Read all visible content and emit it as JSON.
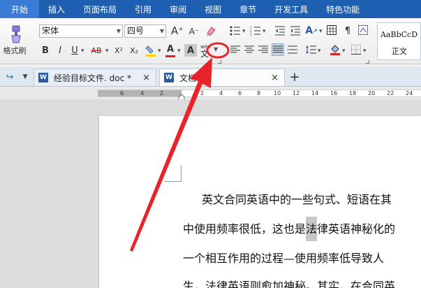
{
  "menubar": {
    "items": [
      "开始",
      "插入",
      "页面布局",
      "引用",
      "审阅",
      "视图",
      "章节",
      "开发工具",
      "特色功能"
    ]
  },
  "ribbon": {
    "format_painter_label": "格式刷",
    "font_name": "宋体",
    "font_size": "四号",
    "bold": "B",
    "italic": "I",
    "underline": "U",
    "strike": "AB",
    "superscript": "X²",
    "subscript": "X₂",
    "font_color_glyph": "A",
    "char_shade_glyph": "A",
    "grow_font": "A⁺",
    "shrink_font": "A⁻",
    "styles_sample": "AaBbCcD",
    "styles_label": "正文"
  },
  "tabs": [
    {
      "label": "经验目标文件. doc *"
    },
    {
      "label": "文档1"
    }
  ],
  "ruler": {
    "numbers": [
      "6",
      "4",
      "2",
      "2",
      "4",
      "6",
      "8",
      "10",
      "12",
      "14",
      "16",
      "18",
      "20",
      "22",
      "24"
    ]
  },
  "document": {
    "lines": [
      "英文合同英语中的一些句式、短语在其",
      "中使用频率很低，这也是",
      "一个相互作用的过程—使用频率低导致人",
      "生，法律英语则愈加神秘。其实，在合同英"
    ],
    "line2_highlight": "法",
    "line2_rest": "律英语神秘化的"
  },
  "colors": {
    "menubar": "#1e5fb2",
    "annotation": "#e8232a",
    "font_color": "#e02020",
    "highlight": "#ffd200"
  }
}
